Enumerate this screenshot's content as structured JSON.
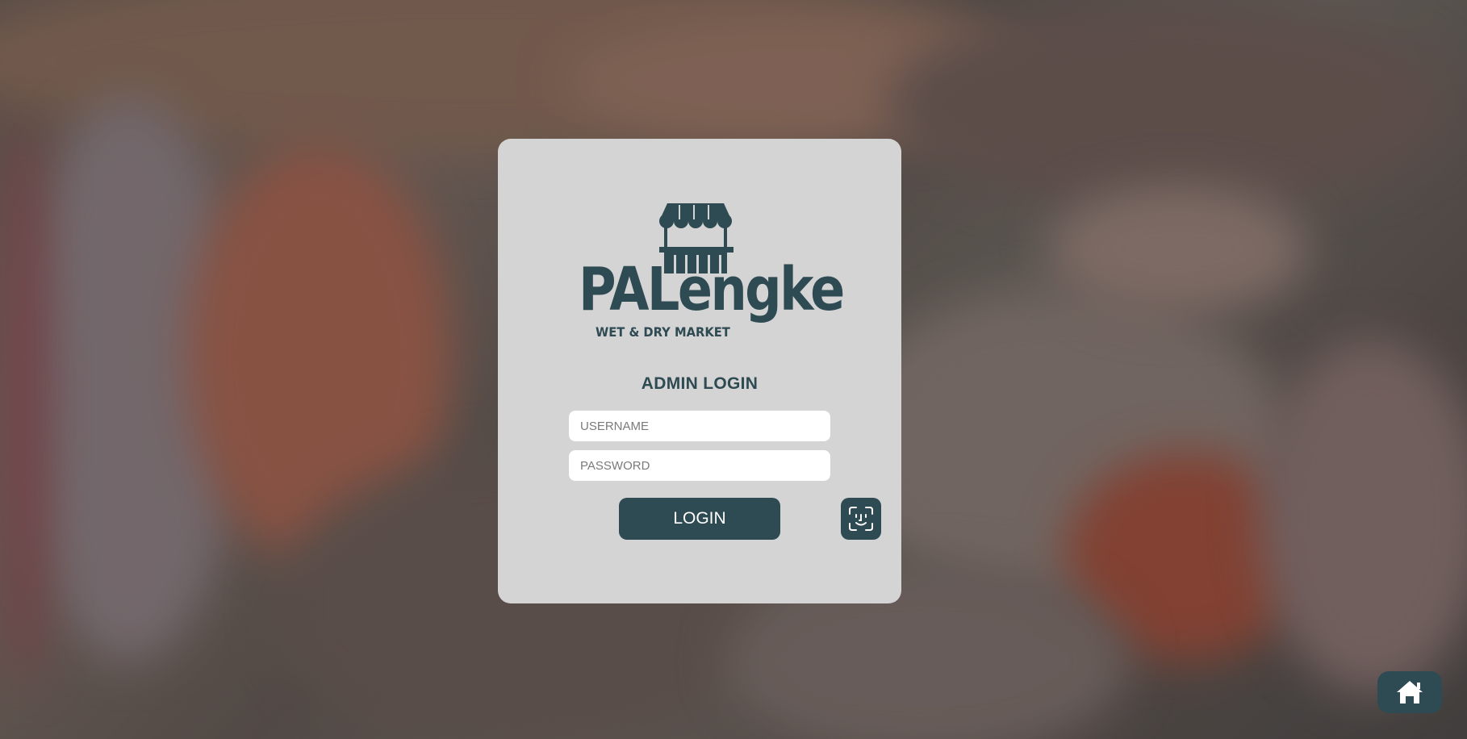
{
  "brand": {
    "name": "PALengke",
    "tagline": "WET & DRY MARKET",
    "color": "#2e4a52"
  },
  "login": {
    "heading": "ADMIN LOGIN",
    "username_placeholder": "USERNAME",
    "password_placeholder": "PASSWORD",
    "username_value": "",
    "password_value": "",
    "submit_label": "LOGIN"
  },
  "icons": {
    "logo": "market-stall-icon",
    "face_login": "face-id-icon",
    "home": "home-icon"
  }
}
